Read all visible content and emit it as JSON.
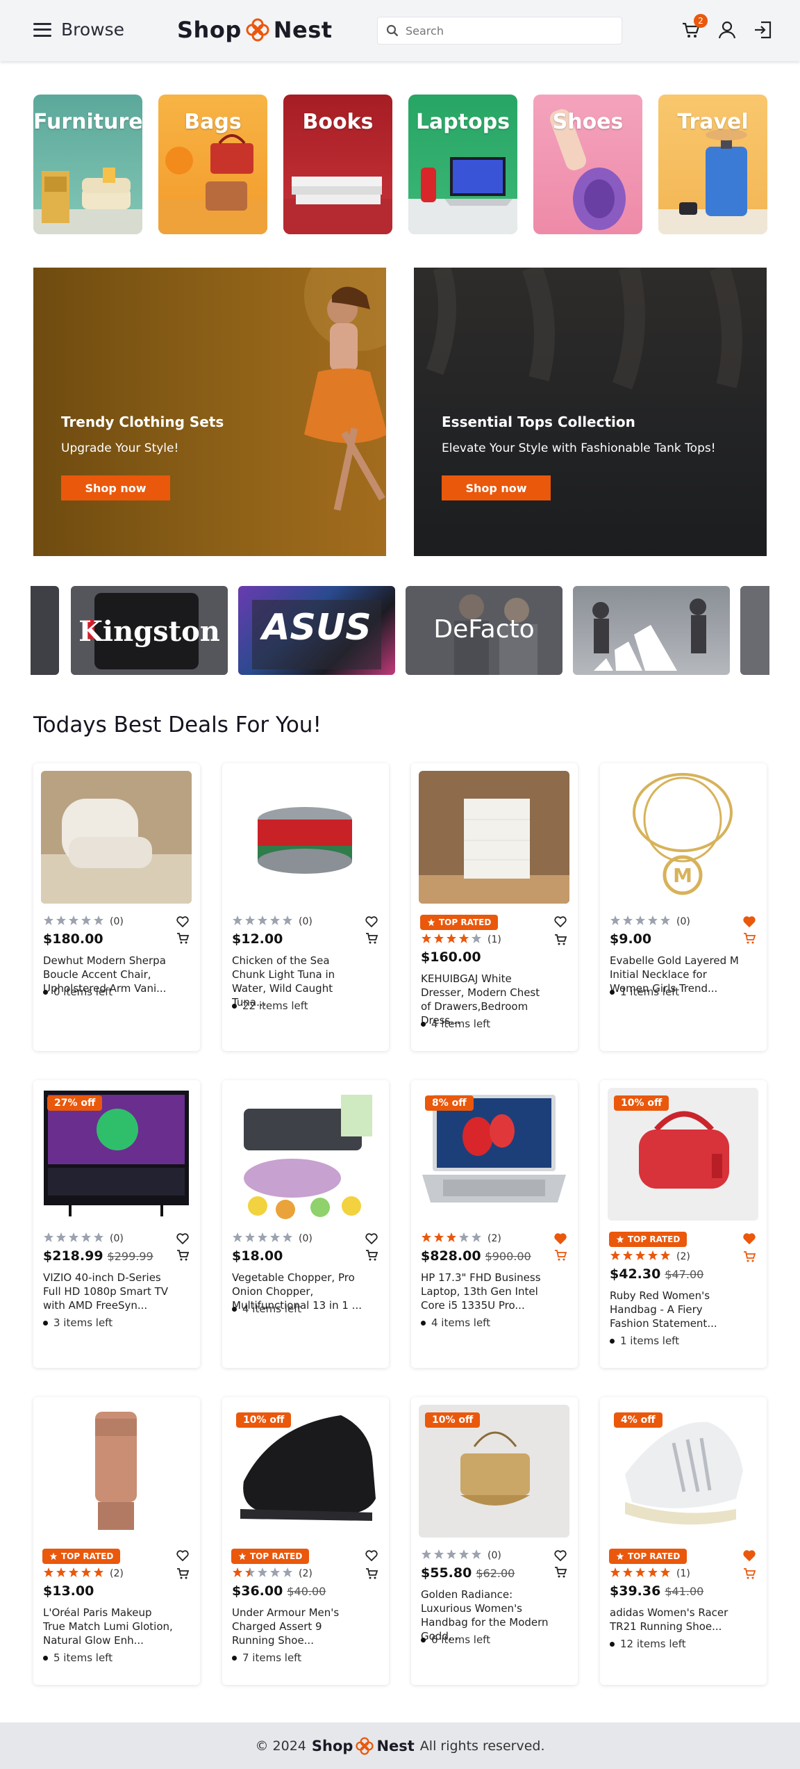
{
  "header": {
    "browse_label": "Browse",
    "logo_left": "Shop",
    "logo_right": "Nest",
    "search_placeholder": "Search",
    "cart_count": "2",
    "accent": "#ea580c"
  },
  "categories": [
    {
      "label": "Furniture",
      "bg": "#5ba89a"
    },
    {
      "label": "Bags",
      "bg": "#f5a83d"
    },
    {
      "label": "Books",
      "bg": "#b4232a"
    },
    {
      "label": "Laptops",
      "bg": "#2fa86a"
    },
    {
      "label": "Shoes",
      "bg": "#f29bb4"
    },
    {
      "label": "Travel",
      "bg": "#f7c46a"
    }
  ],
  "banners": [
    {
      "title": "Trendy Clothing Sets",
      "subtitle": "Upgrade Your Style!",
      "button": "Shop now"
    },
    {
      "title": "Essential Tops Collection",
      "subtitle": "Elevate Your Style with Fashionable Tank Tops!",
      "button": "Shop now"
    }
  ],
  "brands": [
    {
      "label": ""
    },
    {
      "label": "Kingston"
    },
    {
      "label": "ASUS"
    },
    {
      "label": "DeFacto"
    },
    {
      "label": ""
    },
    {
      "label": ""
    }
  ],
  "deals_title": "Todays Best Deals For You!",
  "top_rated_label": "TOP RATED",
  "products": [
    {
      "name": "Dewhut Modern Sherpa Boucle Accent Chair, Upholstered Arm Vani...",
      "price": "$180.00",
      "old_price": "",
      "discount": "",
      "rating": 0,
      "reviews": "(0)",
      "stock": "0 items left",
      "top_rated": false,
      "wished": false
    },
    {
      "name": "Chicken of the Sea Chunk Light Tuna in Water, Wild Caught Tuna...",
      "price": "$12.00",
      "old_price": "",
      "discount": "",
      "rating": 0,
      "reviews": "(0)",
      "stock": "22 items left",
      "top_rated": false,
      "wished": false
    },
    {
      "name": "KEHUIBGAJ White Dresser, Modern Chest of Drawers,Bedroom Dress...",
      "price": "$160.00",
      "old_price": "",
      "discount": "",
      "rating": 4,
      "reviews": "(1)",
      "stock": "4 items left",
      "top_rated": true,
      "wished": false
    },
    {
      "name": "Evabelle Gold Layered M Initial Necklace for Women Girls Trend...",
      "price": "$9.00",
      "old_price": "",
      "discount": "",
      "rating": 0,
      "reviews": "(0)",
      "stock": "1 items left",
      "top_rated": false,
      "wished": true
    },
    {
      "name": "VIZIO 40-inch D-Series Full HD 1080p Smart TV with AMD FreeSyn...",
      "price": "$218.99",
      "old_price": "$299.99",
      "discount": "27% off",
      "rating": 0,
      "reviews": "(0)",
      "stock": "3 items left",
      "top_rated": false,
      "wished": false
    },
    {
      "name": "Vegetable Chopper, Pro Onion Chopper, Multifunctional 13 in 1 ...",
      "price": "$18.00",
      "old_price": "",
      "discount": "",
      "rating": 0,
      "reviews": "(0)",
      "stock": "4 items left",
      "top_rated": false,
      "wished": false
    },
    {
      "name": "HP 17.3\" FHD Business Laptop, 13th Gen Intel Core i5 1335U Pro...",
      "price": "$828.00",
      "old_price": "$900.00",
      "discount": "8% off",
      "rating": 3,
      "reviews": "(2)",
      "stock": "4 items left",
      "top_rated": false,
      "wished": true
    },
    {
      "name": "Ruby Red Women's Handbag - A Fiery Fashion Statement...",
      "price": "$42.30",
      "old_price": "$47.00",
      "discount": "10% off",
      "rating": 5,
      "reviews": "(2)",
      "stock": "1 items left",
      "top_rated": true,
      "wished": true
    },
    {
      "name": "L'Oréal Paris Makeup True Match Lumi Glotion, Natural Glow Enh...",
      "price": "$13.00",
      "old_price": "",
      "discount": "",
      "rating": 5,
      "reviews": "(2)",
      "stock": "5 items left",
      "top_rated": true,
      "wished": false
    },
    {
      "name": "Under Armour Men's Charged Assert 9 Running Shoe...",
      "price": "$36.00",
      "old_price": "$40.00",
      "discount": "10% off",
      "rating": 1.5,
      "reviews": "(2)",
      "stock": "7 items left",
      "top_rated": true,
      "wished": false
    },
    {
      "name": "Golden Radiance: Luxurious Women's Handbag for the Modern Godd...",
      "price": "$55.80",
      "old_price": "$62.00",
      "discount": "10% off",
      "rating": 0,
      "reviews": "(0)",
      "stock": "6 items left",
      "top_rated": false,
      "wished": false
    },
    {
      "name": "adidas Women's Racer TR21 Running Shoe...",
      "price": "$39.36",
      "old_price": "$41.00",
      "discount": "4% off",
      "rating": 5,
      "reviews": "(1)",
      "stock": "12 items left",
      "top_rated": true,
      "wished": true
    }
  ],
  "footer": {
    "prefix": "© 2024",
    "logo_left": "Shop",
    "logo_right": "Nest",
    "suffix": "All rights reserved."
  }
}
